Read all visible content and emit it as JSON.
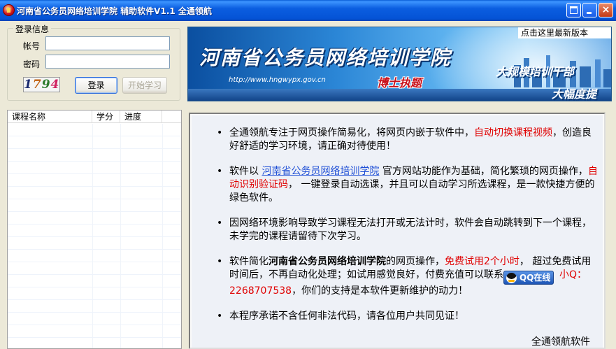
{
  "window": {
    "title": "河南省公务员网络培训学院 辅助软件V1.1 全通领航",
    "controls": {
      "close_glyph": "×"
    }
  },
  "login": {
    "legend": "登录信息",
    "account_label": "帐号",
    "password_label": "密码",
    "account_value": "",
    "password_value": "",
    "captcha": [
      "1",
      "7",
      "9",
      "4"
    ],
    "login_button": "登录",
    "start_button": "开始学习"
  },
  "banner": {
    "title": "河南省公务员网络培训学院",
    "url": "http://www.hngwypx.gov.cn",
    "slogan": "博士执题",
    "tag1": "大规模培训干部",
    "tag2": "大幅度提",
    "update_link": "点击这里最新版本"
  },
  "course_list": {
    "columns": [
      "课程名称",
      "学分",
      "进度"
    ]
  },
  "info": {
    "items": [
      {
        "a": "全通领航专注于网页操作简易化，将网页内嵌于软件中，",
        "b": "自动切换课程视频",
        "c": "，创造良好舒适的学习环境，请正确对待使用！"
      },
      {
        "a": "软件以 ",
        "link": "河南省公务员网络培训学院",
        "b": " 官方网站功能作为基础，简化繁琐的网页操作，",
        "c": "自动识别验证码",
        "d": "， 一键登录自动选课，并且可以自动学习所选课程，是一款快捷方便的绿色软件。"
      },
      {
        "a": "因网络环境影响导致学习课程无法打开或无法计时，软件会自动跳转到下一个课程，未学完的课程请留待下次学习。"
      },
      {
        "a": "软件简化",
        "bold": "河南省公务员网络培训学院",
        "b": "的网页操作，",
        "c": "免费试用2个小时",
        "d": "， 超过免费试用时间后，不再自动化处理；如试用感觉良好，付费充值可以联系",
        "qq_badge": "QQ在线",
        "e": "小Q：2268707538",
        "f": "，你们的支持是本软件更新维护的动力！"
      },
      {
        "a": "本程序承诺不含任何非法代码，请各位用户共同见证！"
      }
    ],
    "signature": "全通领航软件"
  },
  "icons": {
    "app": "app-logo-icon",
    "maximize": "maximize-icon",
    "minimize": "minimize-icon",
    "close": "close-icon",
    "qq": "qq-penguin-icon"
  },
  "colors": {
    "titlebar": "#0553d6",
    "highlight_red": "#e00000",
    "link_blue": "#1f4fd6"
  }
}
